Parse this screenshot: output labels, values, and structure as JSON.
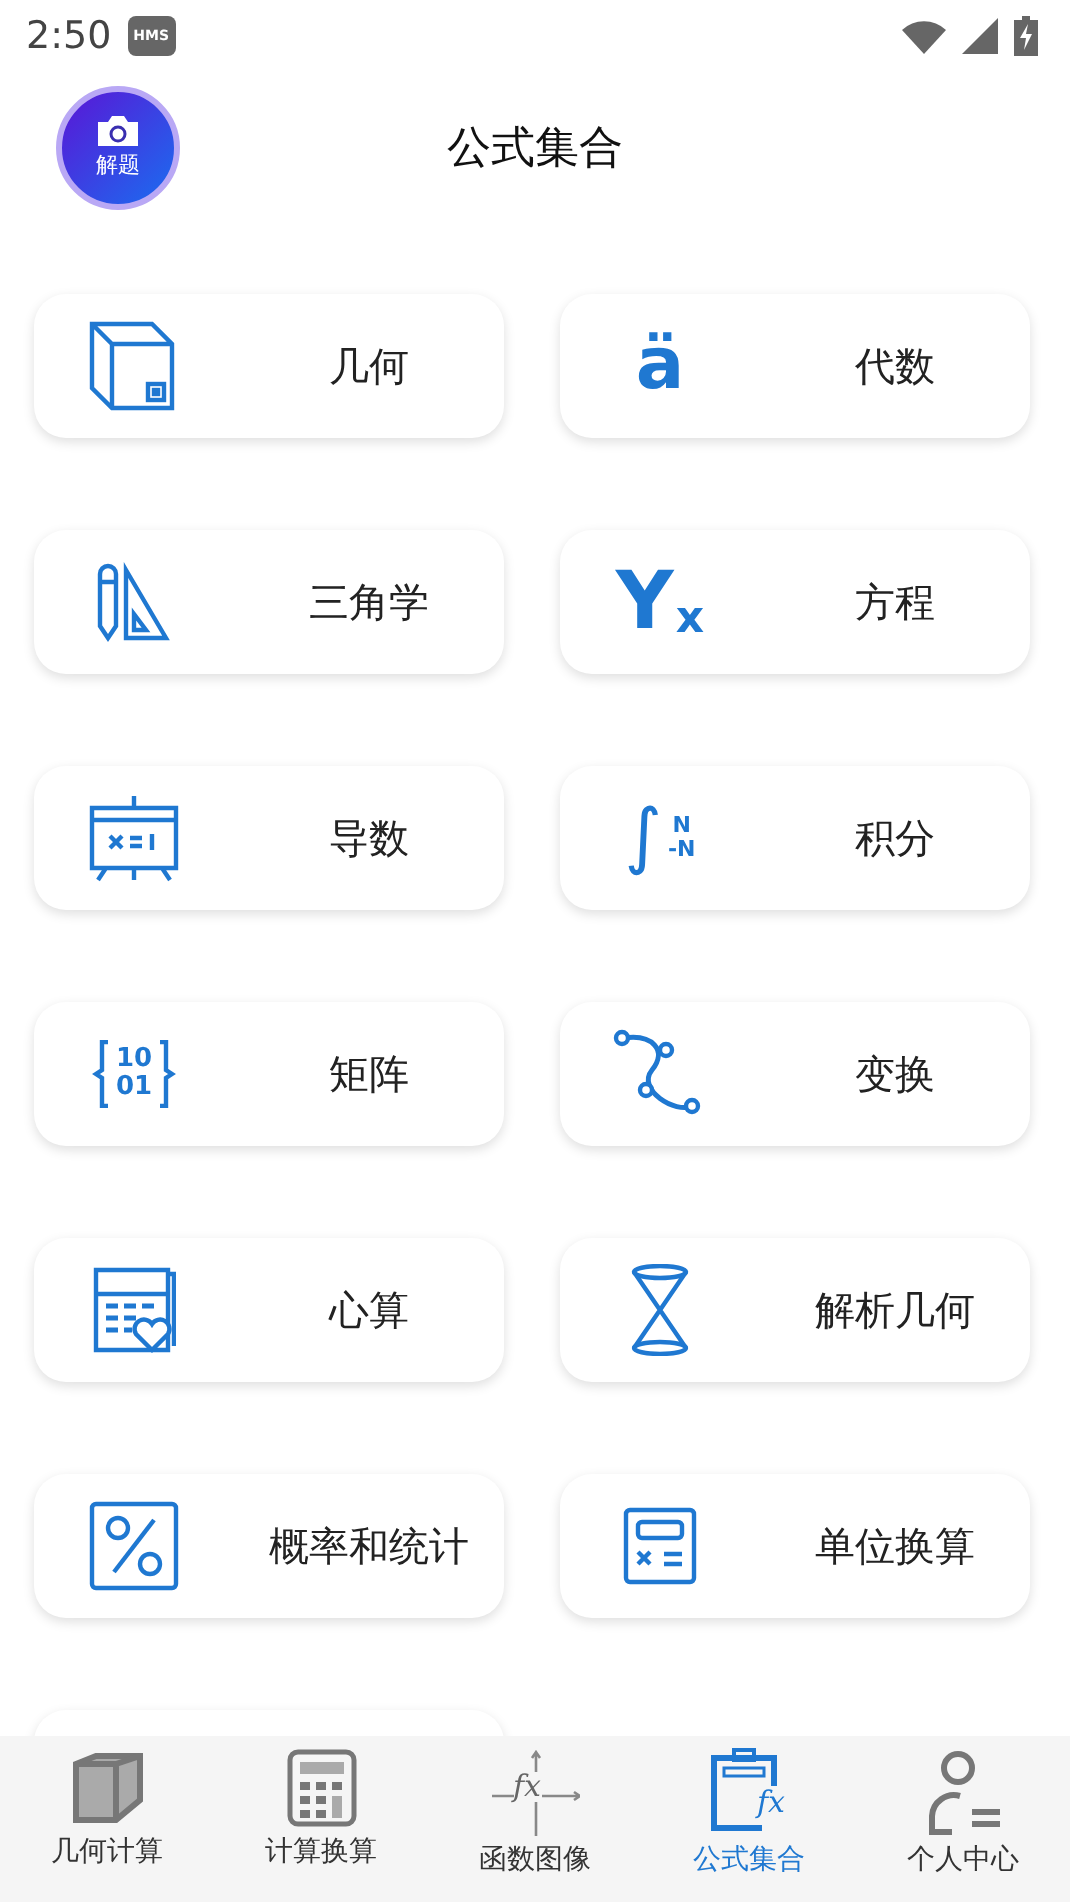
{
  "status_bar": {
    "time": "2:50",
    "badge": "HMS"
  },
  "header": {
    "solve_button": "解题",
    "title": "公式集合"
  },
  "cards": [
    {
      "label": "几何"
    },
    {
      "label": "代数",
      "glyph": {
        "main": "ä"
      }
    },
    {
      "label": "三角学"
    },
    {
      "label": "方程",
      "glyph": {
        "main": "Y",
        "sub": "x"
      }
    },
    {
      "label": "导数"
    },
    {
      "label": "积分",
      "glyph": {
        "main": "∫",
        "upper": "N",
        "lower": "-N"
      }
    },
    {
      "label": "矩阵",
      "glyph": {
        "upper": "10",
        "lower": "01"
      }
    },
    {
      "label": "变换"
    },
    {
      "label": "心算"
    },
    {
      "label": "解析几何"
    },
    {
      "label": "概率和统计"
    },
    {
      "label": "单位换算"
    }
  ],
  "nav": [
    {
      "label": "几何计算",
      "selected": false
    },
    {
      "label": "计算换算",
      "selected": false
    },
    {
      "label": "函数图像",
      "selected": false,
      "glyph": "fx"
    },
    {
      "label": "公式集合",
      "selected": true,
      "glyph": "fx"
    },
    {
      "label": "个人中心",
      "selected": false
    }
  ]
}
